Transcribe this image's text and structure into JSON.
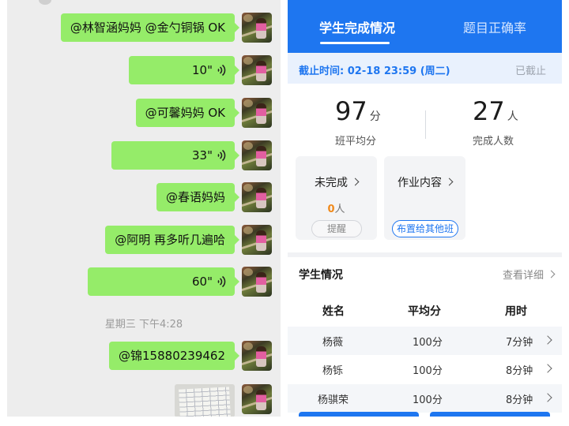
{
  "chat": {
    "messages": [
      {
        "type": "text",
        "text": "@林智涵妈妈 @金勺铜锅 OK"
      },
      {
        "type": "voice",
        "duration": "10\""
      },
      {
        "type": "text",
        "text": "@可馨妈妈 OK"
      },
      {
        "type": "voice",
        "duration": "33\""
      },
      {
        "type": "text",
        "text": "@春语妈妈"
      },
      {
        "type": "text",
        "text": "@阿明 再多听几遍哈"
      },
      {
        "type": "voice",
        "duration": "60\""
      },
      {
        "type": "text",
        "text": "@锦15880239462"
      },
      {
        "type": "image"
      }
    ],
    "timestamp": "星期三 下午4:28",
    "bubble_color": "#95ec69",
    "background_color": "#ededed"
  },
  "app": {
    "tabs": [
      {
        "label": "学生完成情况",
        "active": true
      },
      {
        "label": "题目正确率",
        "active": false
      }
    ],
    "deadline": {
      "text": "截止时间: 02-18 23:59 (周二)",
      "status": "已截止"
    },
    "stats": {
      "average_score": {
        "value": "97",
        "unit": "分",
        "label": "班平均分"
      },
      "completed": {
        "value": "27",
        "unit": "人",
        "label": "完成人数"
      }
    },
    "cards": {
      "incomplete": {
        "title": "未完成",
        "count": "0",
        "unit": "人",
        "button": "提醒"
      },
      "homework": {
        "title": "作业内容",
        "button": "布置给其他班"
      }
    },
    "students": {
      "section_title": "学生情况",
      "view_details": "查看详细",
      "columns": [
        "姓名",
        "平均分",
        "用时"
      ],
      "rows": [
        {
          "name": "杨薇",
          "score": "100分",
          "time": "7分钟"
        },
        {
          "name": "杨铄",
          "score": "100分",
          "time": "8分钟"
        },
        {
          "name": "杨骐荣",
          "score": "100分",
          "time": "8分钟"
        }
      ]
    },
    "accent_color": "#1e76f0",
    "count_color": "#f08a1c"
  }
}
